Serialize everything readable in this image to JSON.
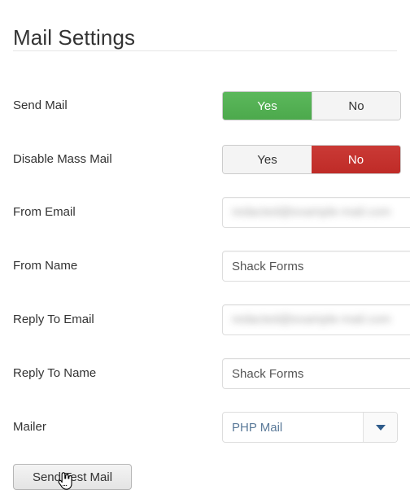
{
  "page": {
    "title": "Mail Settings"
  },
  "fields": [
    {
      "id": "send-mail",
      "label": "Send Mail",
      "type": "toggle",
      "options": [
        "Yes",
        "No"
      ],
      "selected": "Yes",
      "selected_color": "#4cae4c"
    },
    {
      "id": "disable-mass-mail",
      "label": "Disable Mass Mail",
      "type": "toggle",
      "options": [
        "Yes",
        "No"
      ],
      "selected": "No",
      "selected_color": "#c9302c"
    },
    {
      "id": "from-email",
      "label": "From Email",
      "type": "text-redacted",
      "value": "redacted@example-mail.com",
      "placeholder": ""
    },
    {
      "id": "from-name",
      "label": "From Name",
      "type": "text",
      "value": "Shack Forms",
      "placeholder": ""
    },
    {
      "id": "reply-to-email",
      "label": "Reply To Email",
      "type": "text-redacted",
      "value": "redacted@example-mail.com",
      "placeholder": ""
    },
    {
      "id": "reply-to-name",
      "label": "Reply To Name",
      "type": "text",
      "value": "Shack Forms",
      "placeholder": ""
    },
    {
      "id": "mailer",
      "label": "Mailer",
      "type": "select",
      "value": "PHP Mail",
      "options": [
        "PHP Mail"
      ]
    }
  ],
  "actions": {
    "send_test_mail": "Send Test Mail"
  },
  "cursor": {
    "icon": "pointer-hand-cursor"
  },
  "colors": {
    "yes_active": "#4cae4c",
    "no_active": "#c9302c",
    "select_text": "#5b7a99",
    "caret": "#2e5b8a",
    "input_border": "#dddddd",
    "text": "#333333"
  }
}
